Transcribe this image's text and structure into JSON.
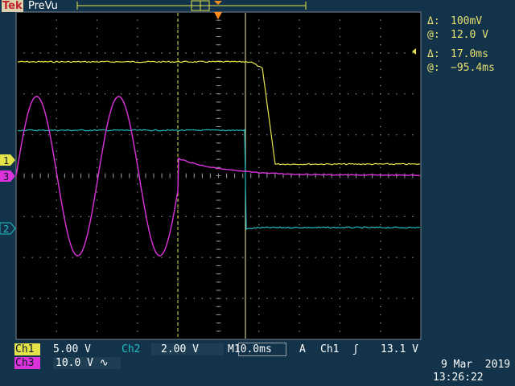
{
  "header": {
    "brand": "Tek",
    "mode": "PreVu"
  },
  "cursor_readouts": {
    "voltage_delta_symbol": "Δ:",
    "voltage_delta": "100mV",
    "voltage_at_symbol": "@:",
    "voltage_at": "12.0 V",
    "time_delta_symbol": "Δ:",
    "time_delta": "17.0ms",
    "time_at_symbol": "@:",
    "time_at": "−95.4ms"
  },
  "channel_markers": {
    "ch1": "1",
    "ch2": "2",
    "ch3": "3"
  },
  "status": {
    "ch1_label": "Ch1",
    "ch1_scale": "5.00 V",
    "ch2_label": "Ch2",
    "ch2_scale": "2.00 V",
    "timebase_prefix": "M",
    "timebase": "10.0ms",
    "trigger_mode": "A",
    "trigger_source": "Ch1",
    "trigger_edge": "ʃ",
    "trigger_level": "13.1 V",
    "ch3_label": "Ch3",
    "ch3_scale": "10.0 V ∿"
  },
  "datetime": {
    "date": "9 Mar  2019",
    "time": "13:26:22"
  },
  "colors": {
    "background": "#123349",
    "ch1": "#e4e44a",
    "ch2": "#21bfc3",
    "ch3": "#dc32dc",
    "trigger_marker": "#ff8c1a"
  },
  "traces": {
    "ch1_high_div": 2.4,
    "ch1_low_div": -0.1,
    "ch2_before_div": 1.2,
    "ch2_after_div": -1.4,
    "ch3_sine_cycles": 2.5
  }
}
